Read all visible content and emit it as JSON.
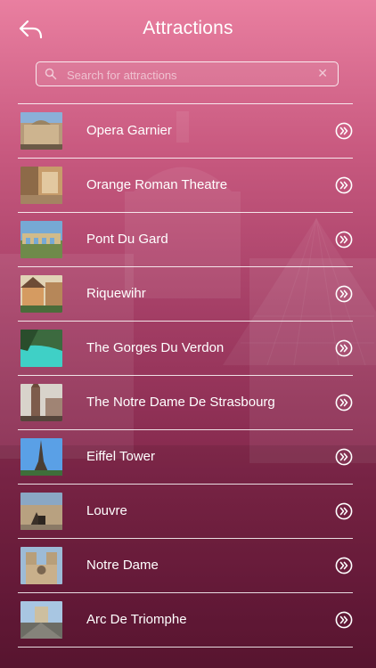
{
  "header": {
    "title": "Attractions"
  },
  "search": {
    "placeholder": "Search for attractions"
  },
  "icons": {
    "back": "back-arrow-icon",
    "search": "search-icon",
    "clear": "clear-icon",
    "row_action": "double-chevron-right-icon"
  },
  "colors": {
    "gradient_top": "#e97fa0",
    "gradient_bottom": "#5f1634",
    "foreground": "#ffffff"
  },
  "attractions": [
    {
      "label": "Opera Garnier"
    },
    {
      "label": "Orange Roman Theatre"
    },
    {
      "label": "Pont Du Gard"
    },
    {
      "label": "Riquewihr"
    },
    {
      "label": "The Gorges Du Verdon"
    },
    {
      "label": "The Notre Dame De Strasbourg"
    },
    {
      "label": "Eiffel Tower"
    },
    {
      "label": "Louvre"
    },
    {
      "label": "Notre Dame"
    },
    {
      "label": "Arc De Triomphe"
    }
  ]
}
